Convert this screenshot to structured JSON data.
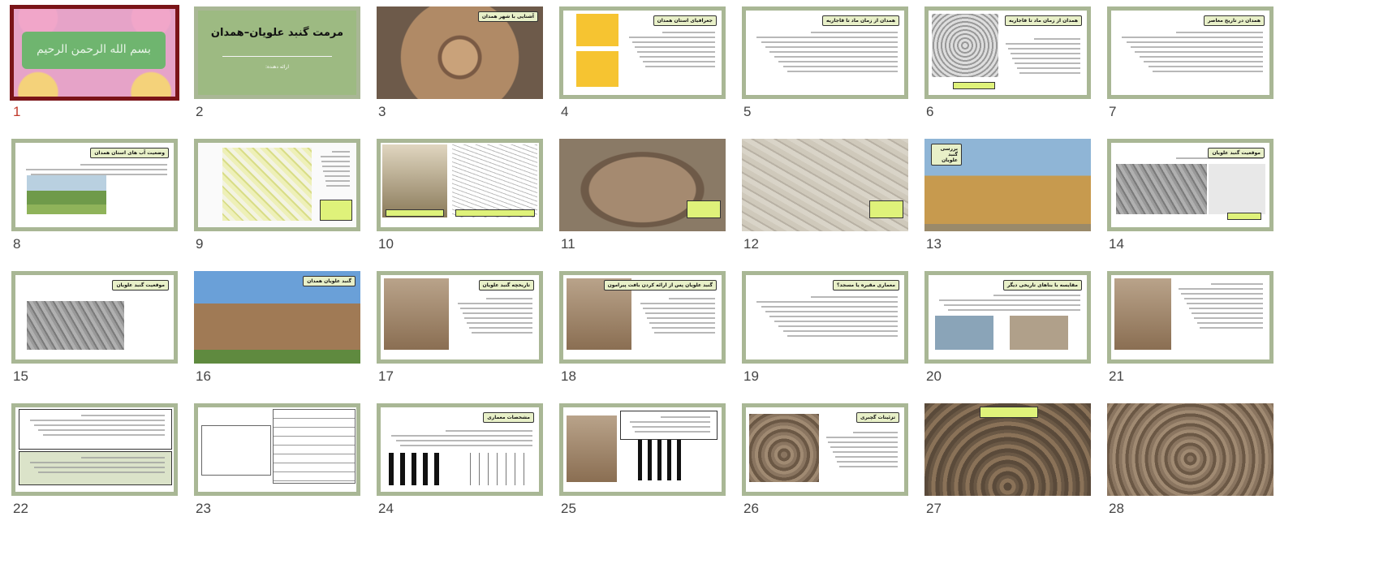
{
  "slides": [
    {
      "number": "1",
      "title": "",
      "text": "بسم الله الرحمن الرحيم",
      "selected": true,
      "kind": "bismillah"
    },
    {
      "number": "2",
      "title": "مرمت گنبد علویان–همدان",
      "subtitle": "ارائه دهنده:",
      "kind": "titleSlide"
    },
    {
      "number": "3",
      "title": "آشنایی با شهر همدان",
      "kind": "photoCity"
    },
    {
      "number": "4",
      "title": "جغرافیای استان همدان",
      "kind": "maps"
    },
    {
      "number": "5",
      "title": "همدان از زمان ماد تا قاجاریه",
      "kind": "text"
    },
    {
      "number": "6",
      "title": "همدان از زمان ماد تا قاجاریه",
      "kind": "textImage"
    },
    {
      "number": "7",
      "title": "همدان در تاریخ معاصر",
      "kind": "text"
    },
    {
      "number": "8",
      "title": "وضعیت آب های استان همدان",
      "kind": "textPhoto"
    },
    {
      "number": "9",
      "title": "",
      "kind": "cityMap"
    },
    {
      "number": "10",
      "title": "",
      "kind": "twoImages"
    },
    {
      "number": "11",
      "title": "",
      "kind": "aerial"
    },
    {
      "number": "12",
      "title": "",
      "kind": "aerialOld"
    },
    {
      "number": "13",
      "title": "بررسی گنبد علویان",
      "kind": "monument"
    },
    {
      "number": "14",
      "title": "موقعیت گنبد علویان",
      "kind": "mapImage"
    },
    {
      "number": "15",
      "title": "موقعیت گنبد علویان",
      "kind": "mapAnnotated"
    },
    {
      "number": "16",
      "title": "گنبد علویان همدان",
      "kind": "monumentPhoto"
    },
    {
      "number": "17",
      "title": "تاریخچه گنبد علویان",
      "kind": "textImageLeft"
    },
    {
      "number": "18",
      "title": "گنبد علویان پس از ارائه کردن بافت پیرامون",
      "kind": "textImageLeft"
    },
    {
      "number": "19",
      "title": "معماری مقبره یا مسجد؟",
      "kind": "text"
    },
    {
      "number": "20",
      "title": "مقایسه با بناهای تاریخی دیگر",
      "kind": "textTwoImages"
    },
    {
      "number": "21",
      "title": "",
      "kind": "textImageLeft2"
    },
    {
      "number": "22",
      "title": "",
      "kind": "boxedText"
    },
    {
      "number": "23",
      "title": "",
      "kind": "tableDrawings"
    },
    {
      "number": "24",
      "title": "مشخصات معماری",
      "kind": "plans"
    },
    {
      "number": "25",
      "title": "",
      "kind": "photoPlan"
    },
    {
      "number": "26",
      "title": "تزئینات گچبری",
      "kind": "stuccoText"
    },
    {
      "number": "27",
      "title": "",
      "kind": "stuccoPhoto"
    },
    {
      "number": "28",
      "title": "",
      "kind": "stuccoDetail"
    }
  ]
}
